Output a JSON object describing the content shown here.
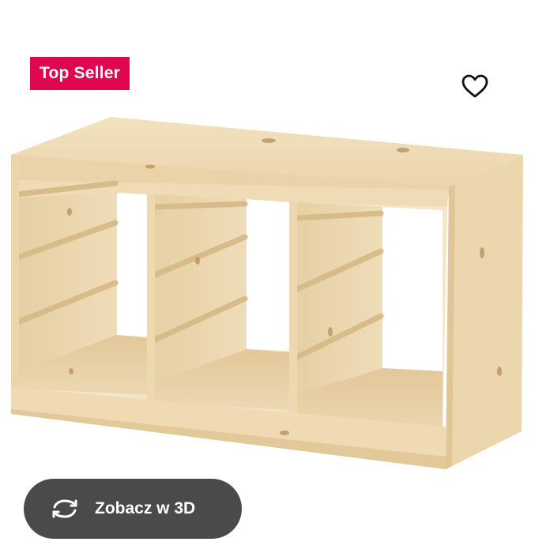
{
  "badge": {
    "label": "Top Seller",
    "color": "#e00751"
  },
  "favourite": {
    "icon": "heart-outline-icon"
  },
  "product_image": {
    "description_icon": "storage-frame-image",
    "wood_color": "#f3e2c0"
  },
  "view_3d": {
    "label": "Zobacz w 3D",
    "icon": "rotate-arrows-icon",
    "background": "#4a4a4a"
  }
}
